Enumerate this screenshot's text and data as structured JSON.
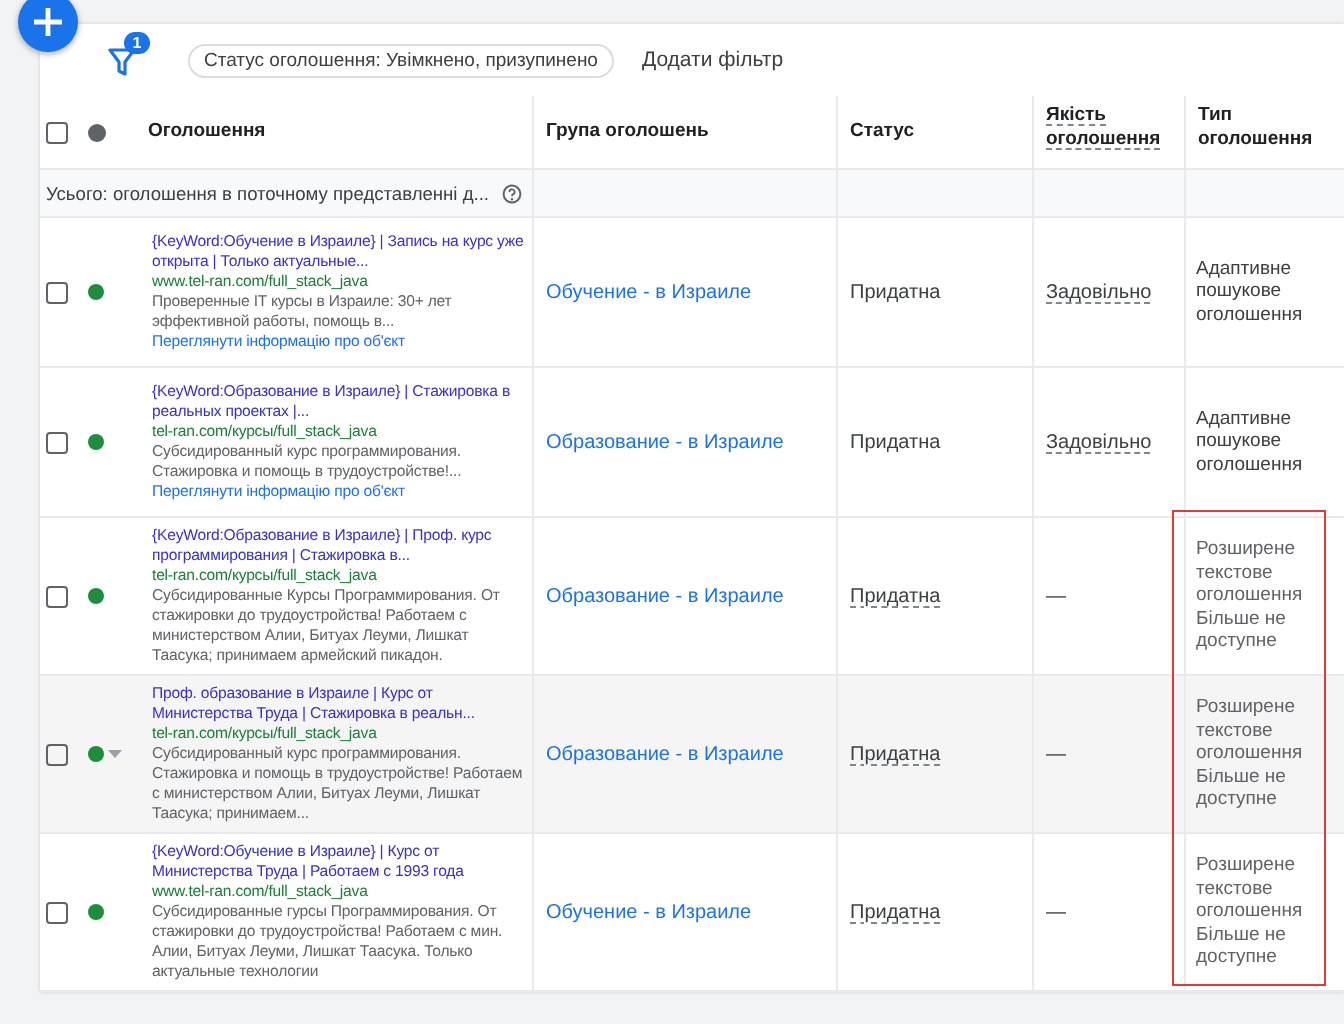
{
  "toolbar": {
    "filter_badge": "1",
    "filter_chip": "Статус оголошення: Увімкнено, призупинено",
    "add_filter": "Додати фільтр"
  },
  "table": {
    "select_all_checked": false,
    "columns": [
      {
        "label": "Оголошення",
        "underlined": false
      },
      {
        "label": "Група оголошень",
        "underlined": false
      },
      {
        "label": "Статус",
        "underlined": false
      },
      {
        "label": "Якість оголошення",
        "underlined": true
      },
      {
        "label": "Тип оголошення",
        "underlined": false
      }
    ],
    "total_row": "Усього: оголошення в поточному представленні д...",
    "rows": [
      {
        "checked": false,
        "enabled": true,
        "hovered": false,
        "headline": "{KeyWord:Обучение в Израиле} | Запись на курс уже открыта | Только актуальные...",
        "url": "www.tel-ran.com/full_stack_java",
        "description": "Проверенные IT курсы в Израиле: 30+ лет эффективной работы, помощь в...",
        "link": "Переглянути інформацію про об'єкт",
        "group": "Обучение - в Израиле",
        "status": "Придатна",
        "status_underlined": false,
        "quality": "Задовільно",
        "quality_underlined": true,
        "type": "Адаптивне пошукове оголошення",
        "flagged": false
      },
      {
        "checked": false,
        "enabled": true,
        "hovered": false,
        "headline": "{KeyWord:Образование в Израиле} | Стажировка в реальных проектах |...",
        "url": "tel-ran.com/курсы/full_stack_java",
        "description": "Субсидированный курс программирования. Стажировка и помощь в трудоустройстве!...",
        "link": "Переглянути інформацію про об'єкт",
        "group": "Образование - в Израиле",
        "status": "Придатна",
        "status_underlined": false,
        "quality": "Задовільно",
        "quality_underlined": true,
        "type": "Адаптивне пошукове оголошення",
        "flagged": false
      },
      {
        "checked": false,
        "enabled": true,
        "hovered": false,
        "headline": "{KeyWord:Образование в Израиле} | Проф. курс программирования | Стажировка в...",
        "url": "tel-ran.com/курсы/full_stack_java",
        "description": "Субсидированные Курсы Программирования. От стажировки до трудоустройства! Работаем с министерством Алии, Битуах Леуми, Лишкат Таасука; принимаем армейский пикадон.",
        "group": "Образование - в Израиле",
        "status": "Придатна",
        "status_underlined": true,
        "quality": "—",
        "quality_underlined": false,
        "type": "Розширене текстове оголошення Більше не доступне",
        "flagged": true
      },
      {
        "checked": false,
        "enabled": true,
        "hovered": true,
        "headline": "Проф. образование в Израиле | Курс от Министерства Труда | Стажировка в реальн...",
        "url": "tel-ran.com/курсы/full_stack_java",
        "description": "Субсидированный курс программирования. Стажировка и помощь в трудоустройстве! Работаем с министерством Алии, Битуах Леуми, Лишкат Таасука; принимаем...",
        "group": "Образование - в Израиле",
        "status": "Придатна",
        "status_underlined": true,
        "quality": "—",
        "quality_underlined": false,
        "type": "Розширене текстове оголошення Більше не доступне",
        "flagged": true
      },
      {
        "checked": false,
        "enabled": true,
        "hovered": false,
        "headline": "{KeyWord:Обучение в Израиле} | Курс от Министерства Труда | Работаем с 1993 года",
        "url": "www.tel-ran.com/full_stack_java",
        "description": "Субсидированные гурсы Программирования. От стажировки до трудоустройства! Работаем с мин. Алии, Битуах Леуми, Лишкат Таасука. Только актуальные технологии",
        "group": "Обучение - в Израиле",
        "status": "Придатна",
        "status_underlined": true,
        "quality": "—",
        "quality_underlined": false,
        "type": "Розширене текстове оголошення Більше не доступне",
        "flagged": true
      }
    ]
  }
}
